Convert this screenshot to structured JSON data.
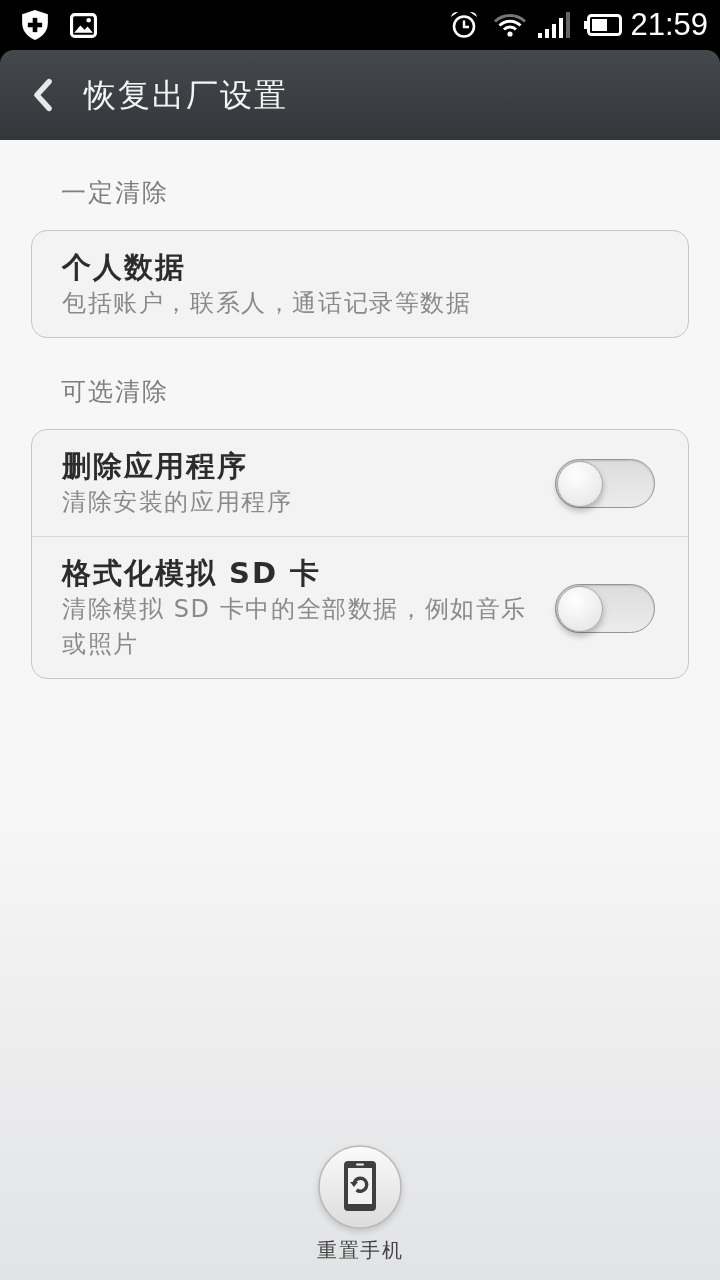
{
  "status_bar": {
    "time": "21:59"
  },
  "title_bar": {
    "title": "恢复出厂设置"
  },
  "sections": [
    {
      "header": "一定清除",
      "items": [
        {
          "kind": "info",
          "title": "个人数据",
          "subtitle": "包括账户，联系人，通话记录等数据"
        }
      ]
    },
    {
      "header": "可选清除",
      "items": [
        {
          "kind": "toggle",
          "title": "删除应用程序",
          "subtitle": "清除安装的应用程序",
          "on": false
        },
        {
          "kind": "toggle",
          "title": "格式化模拟 SD 卡",
          "subtitle": "清除模拟 SD 卡中的全部数据，例如音乐或照片",
          "on": false
        }
      ]
    }
  ],
  "action": {
    "label": "重置手机"
  }
}
